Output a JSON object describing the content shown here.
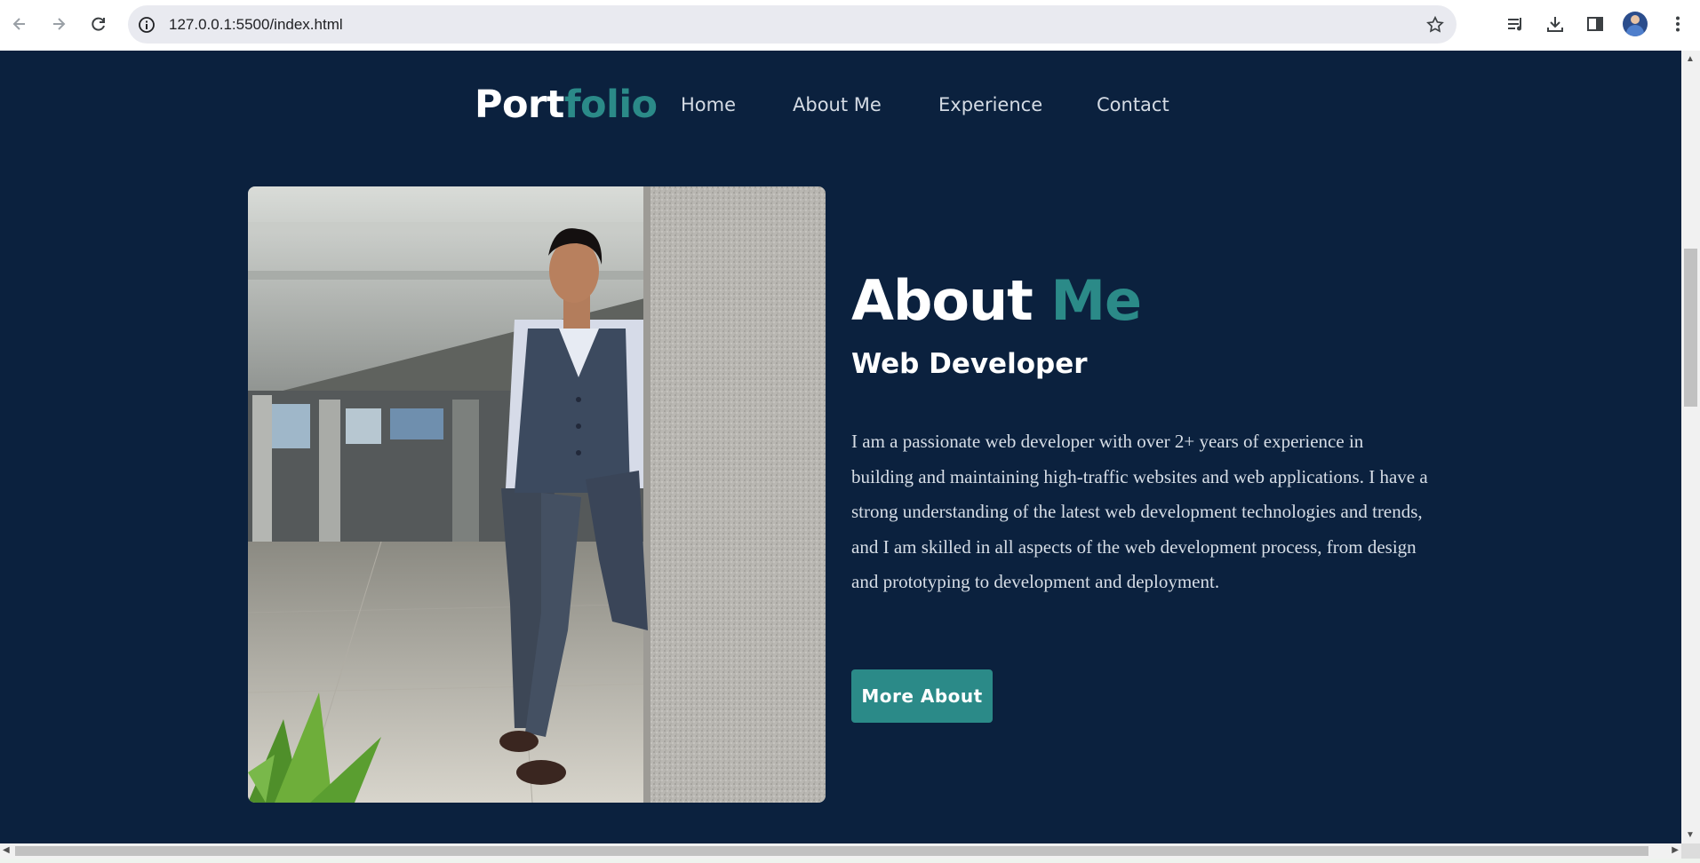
{
  "browser": {
    "url": "127.0.0.1:5500/index.html"
  },
  "nav": {
    "logo_part1": "Port",
    "logo_part2": "folio",
    "links": [
      "Home",
      "About Me",
      "Experience",
      "Contact"
    ]
  },
  "about": {
    "title_part1": "About",
    "title_part2": "Me",
    "subtitle": "Web Developer",
    "paragraph": "I am a passionate web developer with over 2+ years of experience in building and maintaining high-traffic websites and web applications. I have a strong understanding of the latest web development technologies and trends, and I am skilled in all aspects of the web development process, from design and prototyping to development and deployment.",
    "button_label": "More About"
  },
  "colors": {
    "page_background": "#0b213e",
    "accent": "#2b8a88",
    "text_primary": "#ffffff"
  },
  "icons": [
    "back-icon",
    "forward-icon",
    "reload-icon",
    "info-icon",
    "star-icon",
    "media-control-icon",
    "download-icon",
    "side-panel-icon",
    "profile-avatar",
    "menu-icon"
  ]
}
